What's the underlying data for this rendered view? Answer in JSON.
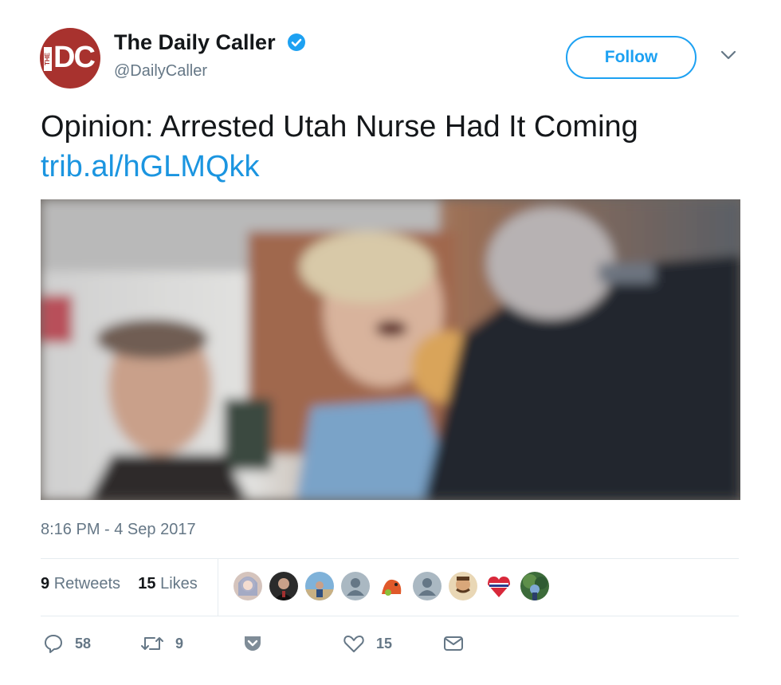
{
  "account": {
    "name": "The Daily Caller",
    "handle": "@DailyCaller",
    "logo_letters": "DC",
    "logo_small": "THE",
    "brand_color": "#a8322e",
    "verified_icon": "verified-badge-icon"
  },
  "follow_button": {
    "label": "Follow",
    "accent": "#1da1f2"
  },
  "tweet": {
    "text": "Opinion: Arrested Utah Nurse Had It Coming",
    "link": "trib.al/hGLMQkk",
    "link_color": "#1b95e0"
  },
  "timestamp": "8:16 PM - 4 Sep 2017",
  "stats": {
    "retweets_count": "9",
    "retweets_label": "Retweets",
    "likes_count": "15",
    "likes_label": "Likes"
  },
  "likers": [
    "liker-avatar-1",
    "liker-avatar-2",
    "liker-avatar-3",
    "liker-avatar-4",
    "liker-avatar-5",
    "liker-avatar-6",
    "liker-avatar-7",
    "liker-avatar-8",
    "liker-avatar-9"
  ],
  "actions": {
    "reply_count": "58",
    "retweet_count": "9",
    "like_count": "15",
    "icons": [
      "reply-icon",
      "retweet-icon",
      "pocket-icon",
      "like-icon",
      "message-icon"
    ]
  }
}
